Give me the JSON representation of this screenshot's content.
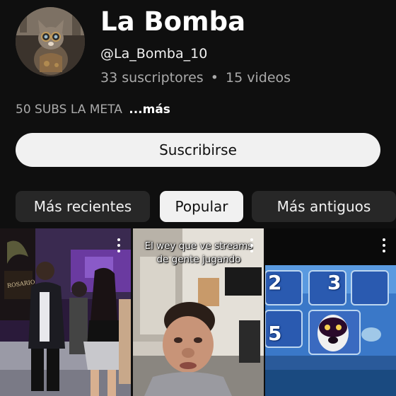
{
  "channel": {
    "name": "La Bomba",
    "handle": "@La_Bomba_10",
    "subscribers": "33 suscriptores",
    "separator": "•",
    "videos": "15 videos",
    "description": "50 SUBS LA META",
    "more_label": "...más"
  },
  "subscribe_label": "Suscribirse",
  "filters": {
    "chips": [
      "Más recientes",
      "Popular",
      "Más antiguos"
    ],
    "selected": "Popular"
  },
  "videos": [
    {
      "caption": "",
      "sign_text": "ROSARIO"
    },
    {
      "caption": "El wey que ve streams de gente jugando"
    },
    {
      "caption": "",
      "tiles": [
        "2",
        "3",
        "5"
      ]
    }
  ],
  "colors": {
    "background": "#0f0f0f",
    "chip_background": "#272727",
    "chip_selected_background": "#f1f1f1",
    "subscribe_background": "#f1f1f1",
    "secondary_text": "#aaaaaa"
  },
  "icons": {
    "more_options": "kebab-vertical-icon"
  }
}
